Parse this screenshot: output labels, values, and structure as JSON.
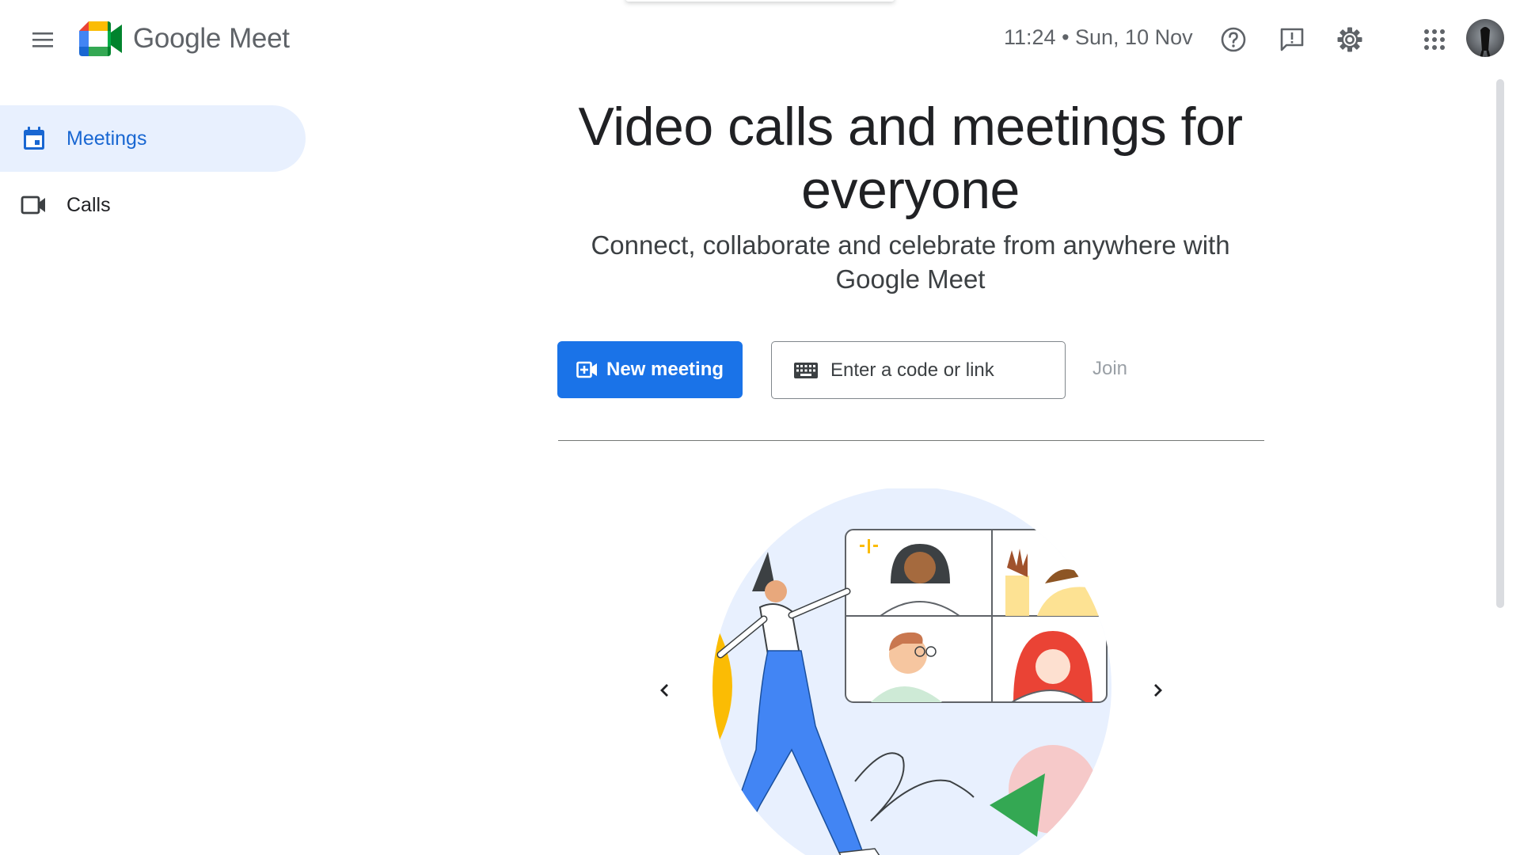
{
  "header": {
    "brand_google": "Google",
    "brand_meet": "Meet",
    "datetime": "11:24 • Sun, 10 Nov",
    "icons": [
      "menu-icon",
      "help-icon",
      "feedback-icon",
      "settings-icon",
      "apps-grid-icon"
    ]
  },
  "sidebar": {
    "items": [
      {
        "label": "Meetings",
        "icon": "calendar-icon",
        "active": true
      },
      {
        "label": "Calls",
        "icon": "video-camera-icon",
        "active": false
      }
    ]
  },
  "main": {
    "title": "Video calls and meetings for everyone",
    "subtitle": "Connect, collaborate and celebrate from anywhere with Google Meet",
    "new_meeting_label": "New meeting",
    "code_placeholder": "Enter a code or link",
    "join_label": "Join"
  },
  "colors": {
    "accent": "#1a73e8",
    "nav_active_bg": "#e8f0fe",
    "nav_active_text": "#1967d2",
    "text_secondary": "#5f6368"
  }
}
